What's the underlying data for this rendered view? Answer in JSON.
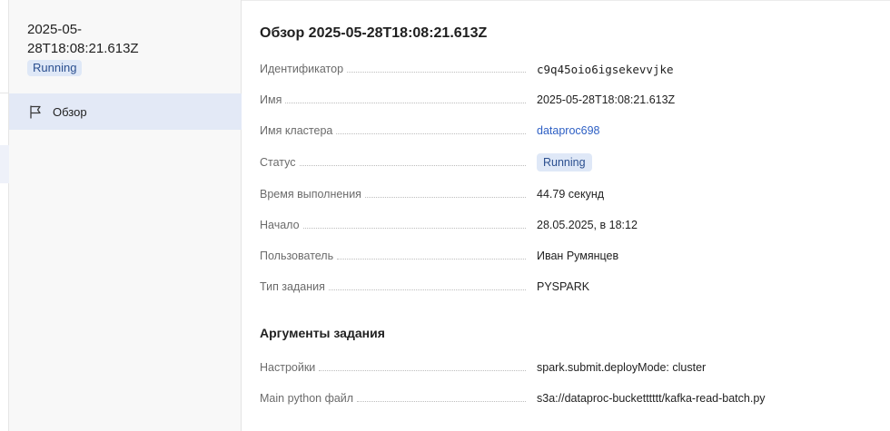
{
  "sidebar": {
    "title": "2025-05-28T18:08:21.613Z",
    "status": "Running",
    "nav": [
      {
        "label": "Обзор",
        "icon": "flag-icon"
      }
    ]
  },
  "main": {
    "title": "Обзор 2025-05-28T18:08:21.613Z",
    "fields": {
      "id": {
        "key": "Идентификатор",
        "value": "c9q45oio6igsekevvjke"
      },
      "name": {
        "key": "Имя",
        "value": "2025-05-28T18:08:21.613Z"
      },
      "cluster": {
        "key": "Имя кластера",
        "value": "dataproc698"
      },
      "status": {
        "key": "Статус",
        "value": "Running"
      },
      "duration": {
        "key": "Время выполнения",
        "value": "44.79 секунд"
      },
      "start": {
        "key": "Начало",
        "value": "28.05.2025, в 18:12"
      },
      "user": {
        "key": "Пользователь",
        "value": "Иван Румянцев"
      },
      "type": {
        "key": "Тип задания",
        "value": "PYSPARK"
      }
    },
    "args_section": {
      "title": "Аргументы задания",
      "fields": {
        "settings": {
          "key": "Настройки",
          "value": "spark.submit.deployMode: cluster"
        },
        "main_file": {
          "key": "Main python файл",
          "value": "s3a://dataproc-bucketttttt/kafka-read-batch.py"
        }
      }
    }
  },
  "colors": {
    "accent_link": "#2d5fc4",
    "badge_bg": "#dfe8f7",
    "badge_text": "#2b4f8f",
    "nav_selected_bg": "#e3e9f6"
  }
}
